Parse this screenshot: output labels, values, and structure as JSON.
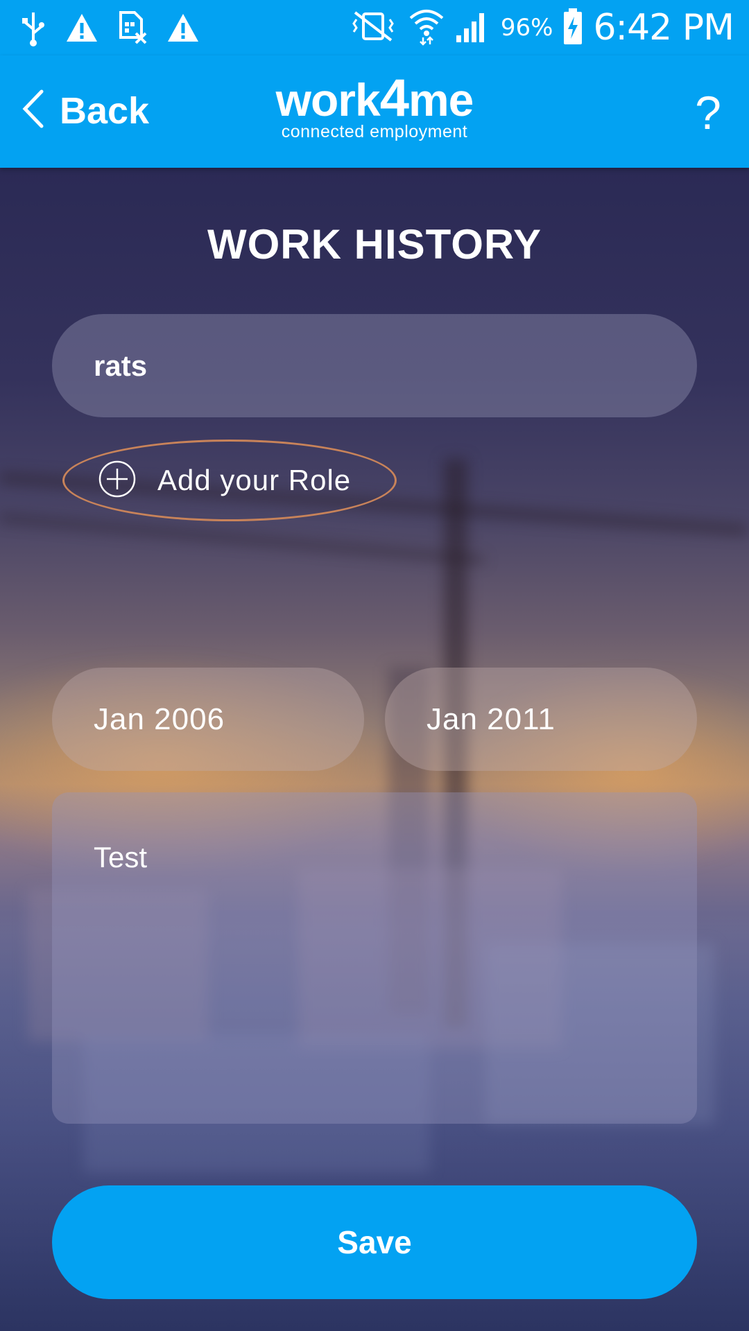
{
  "status_bar": {
    "battery_percent": "96%",
    "time": "6:42 PM",
    "left_icons": [
      "usb-icon",
      "warning-icon",
      "sim-error-icon",
      "warning-icon"
    ],
    "right_icons": [
      "vibrate-off-icon",
      "wifi-icon",
      "signal-icon",
      "battery-charging-icon"
    ]
  },
  "header": {
    "back_label": "Back",
    "logo_word_start": "work",
    "logo_word_four": "4",
    "logo_word_end": "me",
    "logo_tagline": "connected employment",
    "help_label": "?"
  },
  "page": {
    "title": "WORK HISTORY"
  },
  "form": {
    "employer_value": "rats",
    "add_role_label": "Add your Role",
    "start_date": "Jan 2006",
    "end_date": "Jan 2011",
    "description": "Test",
    "save_label": "Save"
  },
  "colors": {
    "accent": "#03a2f2",
    "highlight_ring": "#c8835a"
  }
}
